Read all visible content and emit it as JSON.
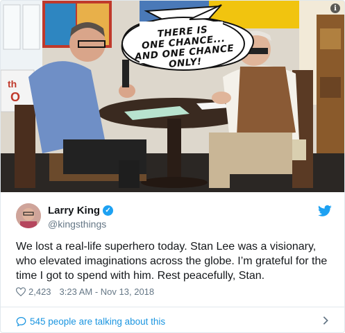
{
  "media": {
    "speech_bubble": [
      "THERE IS",
      "ONE CHANCE...",
      "AND ONE CHANCE",
      "ONLY!"
    ],
    "info_icon": "i"
  },
  "tweet": {
    "author_name": "Larry King",
    "handle": "@kingsthings",
    "verified_icon": "check-icon",
    "text": "We lost a real-life superhero today. Stan Lee was a visionary, who elevated imaginations across the globe. I’m grateful for the time I got to spend with him. Rest peacefully, Stan.",
    "likes": "2,423",
    "timestamp": "3:23 AM - Nov 13, 2018",
    "talking": "545 people are talking about this"
  },
  "colors": {
    "twitter_blue": "#1da1f2",
    "link_blue": "#1b95e0",
    "secondary_text": "#657786",
    "border": "#e1e8ed"
  }
}
